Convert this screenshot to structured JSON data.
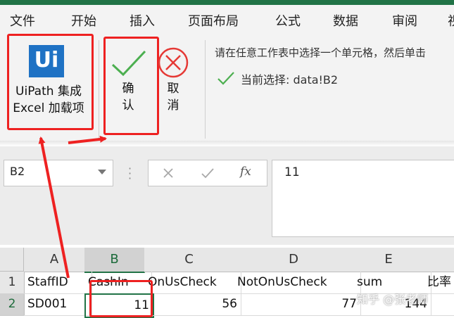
{
  "ribbon_tabs": [
    "文件",
    "开始",
    "插入",
    "页面布局",
    "公式",
    "数据",
    "审阅",
    "视"
  ],
  "uipath": {
    "logo_text": "Ui",
    "label_line1": "UiPath 集成",
    "label_line2": "Excel 加载项"
  },
  "confirm": {
    "label_line1": "确",
    "label_line2": "认"
  },
  "cancel": {
    "label_line1": "取",
    "label_line2": "消"
  },
  "message": {
    "instruction": "请在任意工作表中选择一个单元格，然后单击",
    "current_selection": "当前选择: data!B2"
  },
  "formula_bar": {
    "name_box": "B2",
    "fx_label": "fx",
    "formula_value": "11"
  },
  "grid": {
    "columns": [
      "A",
      "B",
      "C",
      "D",
      "E"
    ],
    "rows": [
      "1",
      "2"
    ],
    "header_row": [
      "StaffID",
      "CashIn",
      "OnUsCheck",
      "NotOnUsCheck",
      "sum",
      "比率"
    ],
    "data_row": [
      "SD001",
      "11",
      "56",
      "77",
      "144"
    ]
  },
  "watermark": "知乎 @张老师",
  "colors": {
    "excel_green": "#217346",
    "annotation_red": "#ee2121",
    "uipath_blue": "#1f72c4",
    "check_green": "#4caf50"
  }
}
